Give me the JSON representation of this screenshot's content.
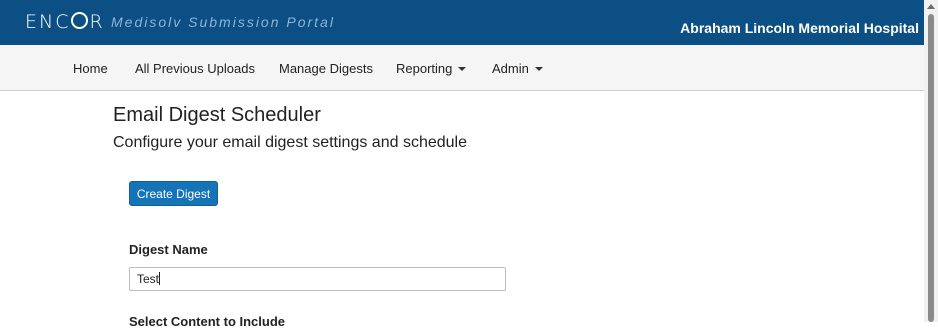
{
  "header": {
    "logo_text_1": "ENC",
    "logo_text_2": "R",
    "portal_title": "Medisolv Submission Portal",
    "hospital_name": "Abraham Lincoln Memorial Hospital"
  },
  "nav": {
    "home": "Home",
    "previous_uploads": "All Previous Uploads",
    "manage_digests": "Manage Digests",
    "reporting": "Reporting",
    "admin": "Admin"
  },
  "main": {
    "title": "Email Digest Scheduler",
    "subtitle": "Configure your email digest settings and schedule",
    "create_button": "Create Digest",
    "digest_name_label": "Digest Name",
    "digest_name_value": "Test",
    "content_section_label": "Select Content to Include"
  },
  "colors": {
    "header_bg": "#0b4f84",
    "nav_bg": "#f5f5f5",
    "primary_button": "#1573b8"
  }
}
